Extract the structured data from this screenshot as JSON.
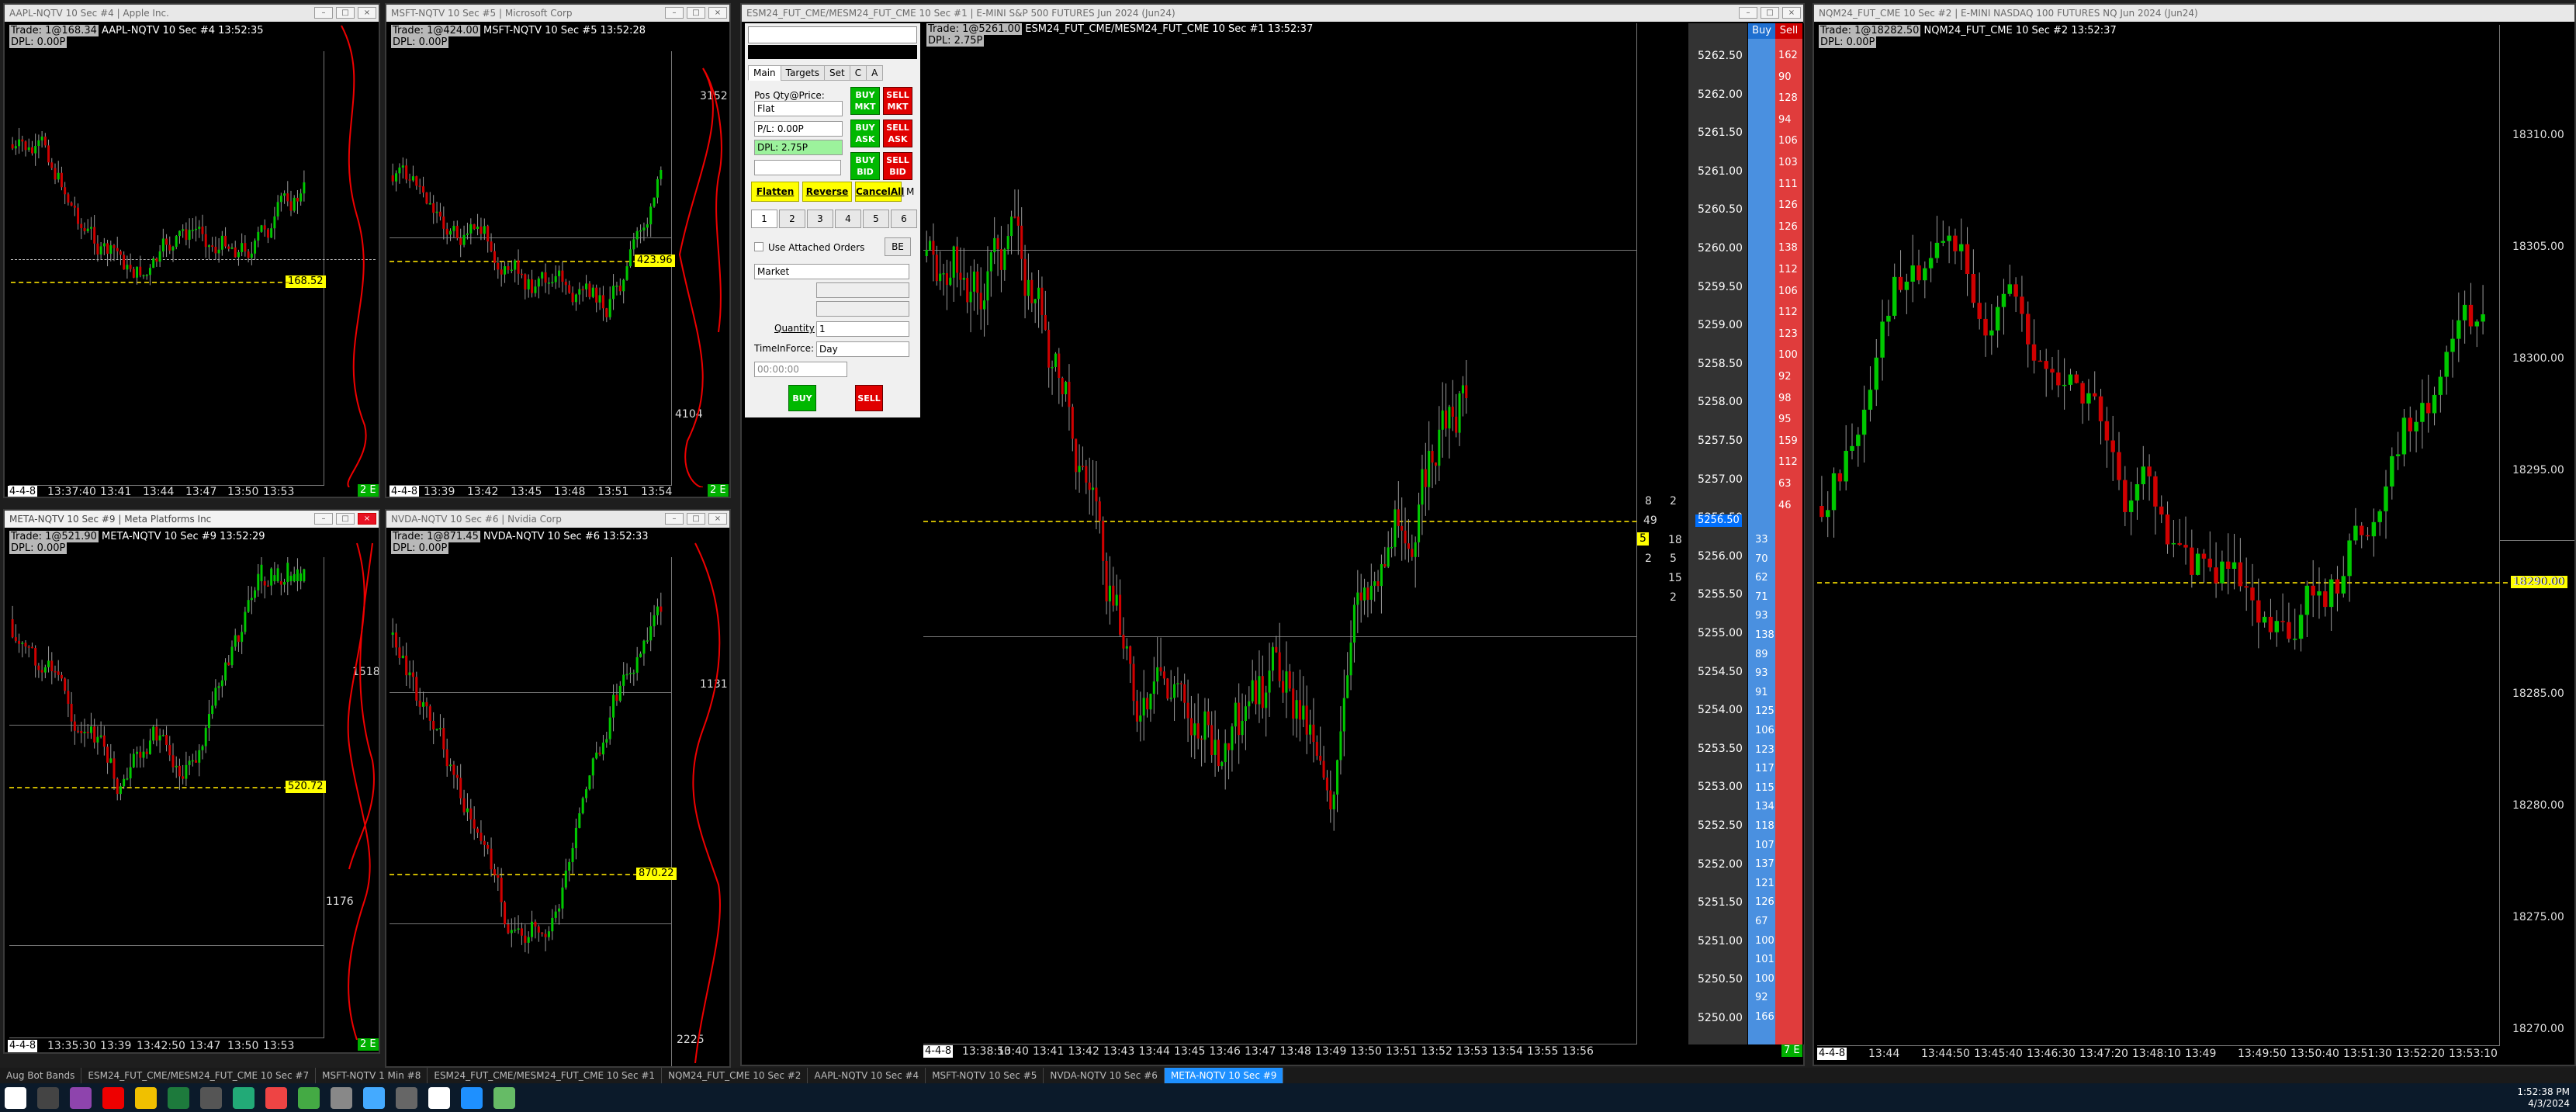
{
  "windows": {
    "aapl": {
      "title": "AAPL-NQTV  10 Sec  #4 | Apple Inc.",
      "trade": "Trade: 1@168.34",
      "line": "AAPL-NQTV  10 Sec  #4 13:52:35",
      "dpl": "DPL: 0.00P",
      "price": "168.52",
      "xticks": [
        "13:37:40",
        "13:41",
        "13:44",
        "13:47",
        "13:50",
        "13:53"
      ],
      "xstart": "4-4-8",
      "zoom": "2 E"
    },
    "msft": {
      "title": "MSFT-NQTV  10 Sec  #5 | Microsoft Corp",
      "trade": "Trade: 1@424.00",
      "line": "MSFT-NQTV  10 Sec  #5 13:52:28",
      "dpl": "DPL: 0.00P",
      "price": "423.96",
      "vol_top": "3152",
      "vol_bot": "4104",
      "xticks": [
        "13:39",
        "13:42",
        "13:45",
        "13:48",
        "13:51",
        "13:54"
      ],
      "xstart": "4-4-8",
      "zoom": "2 E"
    },
    "meta": {
      "title": "META-NQTV  10 Sec  #9 | Meta Platforms Inc",
      "trade": "Trade: 1@521.90",
      "line": "META-NQTV  10 Sec  #9 13:52:29",
      "dpl": "DPL: 0.00P",
      "price": "520.72",
      "vol_top": "1518",
      "vol_bot": "1176",
      "xticks": [
        "13:35:30",
        "13:39",
        "13:42:50",
        "13:47",
        "13:50",
        "13:53"
      ],
      "xstart": "4-4-8",
      "zoom": "2 E"
    },
    "nvda": {
      "title": "NVDA-NQTV  10 Sec  #6 | Nvidia Corp",
      "trade": "Trade: 1@871.45",
      "line": "NVDA-NQTV  10 Sec  #6 13:52:33",
      "dpl": "DPL: 0.00P",
      "price": "870.22",
      "vol_top": "1131",
      "vol_bot": "2225"
    },
    "esm": {
      "title": "ESM24_FUT_CME/MESM24_FUT_CME  10 Sec  #1 | E-MINI S&P 500 FUTURES Jun 2024 (Jun24)",
      "trade": "Trade: 1@5261.00",
      "line": "ESM24_FUT_CME/MESM24_FUT_CME  10 Sec  #1 13:52:37",
      "dpl": "DPL: 2.75P",
      "xticks": [
        "13:38:50",
        "13:40",
        "13:41",
        "13:42",
        "13:43",
        "13:44",
        "13:45",
        "13:46",
        "13:47",
        "13:48",
        "13:49",
        "13:50",
        "13:51",
        "13:52",
        "13:53",
        "13:54",
        "13:55",
        "13:56"
      ],
      "xstart": "4-4-8"
    },
    "nqm": {
      "title": "NQM24_FUT_CME  10 Sec  #2 | E-MINI NASDAQ 100 FUTURES NQ Jun 2024 (Jun24)",
      "trade": "Trade: 1@18282.50",
      "line": "NQM24_FUT_CME  10 Sec  #2 13:52:37",
      "dpl": "DPL: 0.00P",
      "price": "18290.00",
      "yticks": [
        "18310.00",
        "18305.00",
        "18300.00",
        "18295.00",
        "18290.00",
        "18285.00",
        "18280.00",
        "18275.00",
        "18270.00"
      ],
      "xticks": [
        "13:44",
        "13:44:50",
        "13:45:40",
        "13:46:30",
        "13:47:20",
        "13:48:10",
        "13:49",
        "13:49:50",
        "13:50:40",
        "13:51:30",
        "13:52:20",
        "13:53:10"
      ],
      "xstart": "4-4-8"
    }
  },
  "trade_panel": {
    "tabs": [
      "Main",
      "Targets",
      "Set",
      "C",
      "A"
    ],
    "pos_label": "Pos Qty@Price:",
    "pos_value": "Flat",
    "pl": "P/L: 0.00P",
    "dpl": "DPL: 2.75P",
    "buy_mkt": "BUY MKT",
    "sell_mkt": "SELL MKT",
    "buy_ask": "BUY ASK",
    "sell_ask": "SELL ASK",
    "buy_bid": "BUY BID",
    "sell_bid": "SELL BID",
    "flatten": "Flatten",
    "reverse": "Reverse",
    "cancel_all": "CancelAll",
    "m": "M",
    "qty_tabs": [
      "1",
      "2",
      "3",
      "4",
      "5",
      "6"
    ],
    "attached": "Use Attached Orders",
    "be": "BE",
    "order_type": "Market",
    "qty_label": "Quantity",
    "qty_value": "1",
    "tif_label": "TimeInForce:",
    "tif_value": "Day",
    "time": "00:00:00",
    "buy": "BUY",
    "sell": "SELL"
  },
  "dom": {
    "buy_header": "Buy",
    "sell_header": "Sell",
    "current_price": "5256.50",
    "prices": [
      "5262.50",
      "5262.00",
      "5261.50",
      "5261.00",
      "5260.50",
      "5260.00",
      "5259.50",
      "5259.00",
      "5258.50",
      "5258.00",
      "5257.50",
      "5257.00",
      "5256.50",
      "5256.00",
      "5255.50",
      "5255.00",
      "5254.50",
      "5254.00",
      "5253.50",
      "5253.00",
      "5252.50",
      "5252.00",
      "5251.50",
      "5251.00",
      "5250.50",
      "5250.00"
    ],
    "sell_sizes": [
      "162",
      "90",
      "128",
      "94",
      "106",
      "103",
      "111",
      "126",
      "126",
      "138",
      "112",
      "106",
      "112",
      "123",
      "100",
      "92",
      "98",
      "95",
      "159",
      "112",
      "63",
      "46"
    ],
    "buy_sizes": [
      "33",
      "70",
      "62",
      "71",
      "93",
      "138",
      "89",
      "93",
      "91",
      "125",
      "106",
      "123",
      "117",
      "115",
      "134",
      "118",
      "107",
      "137",
      "121",
      "126",
      "67",
      "100",
      "101",
      "100",
      "92",
      "166"
    ],
    "orders_left": [
      "8",
      "49",
      "",
      "2"
    ],
    "orders_mid": [
      "2",
      "5",
      "18",
      "5",
      "15",
      "2"
    ],
    "zoom": "7 E"
  },
  "tabstrip": [
    "Aug Bot Bands",
    "ESM24_FUT_CME/MESM24_FUT_CME  10 Sec #7",
    "MSFT-NQTV  1 Min  #8",
    "ESM24_FUT_CME/MESM24_FUT_CME  10 Sec  #1",
    "NQM24_FUT_CME  10 Sec  #2",
    "AAPL-NQTV  10 Sec  #4",
    "MSFT-NQTV  10 Sec  #5",
    "NVDA-NQTV  10 Sec  #6",
    "META-NQTV  10 Sec  #9"
  ],
  "clock": {
    "time": "1:52:38 PM",
    "date": "4/3/2024"
  },
  "colors": {
    "up": "#00c800",
    "down": "#d00000",
    "price_marker": "#ffff00",
    "buy": "#4a90e0",
    "sell": "#e03c3c"
  }
}
